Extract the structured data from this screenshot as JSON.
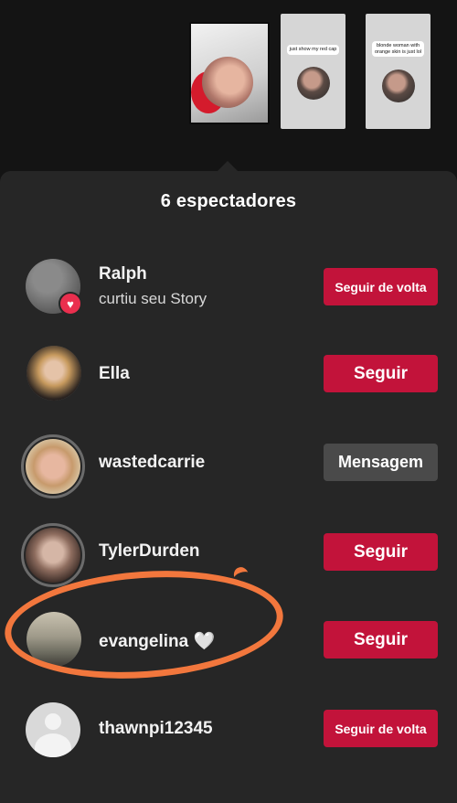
{
  "story_thumbnails": [
    {
      "caption": ""
    },
    {
      "caption": "just show my red cap"
    },
    {
      "caption": "blonde woman with orange skin is just lol"
    }
  ],
  "sheet": {
    "title": "6 espectadores"
  },
  "viewers": [
    {
      "name": "Ralph",
      "subtitle": "curtiu seu Story",
      "button": "Seguir de volta",
      "button_style": "red",
      "liked": true,
      "icon": "heart-icon"
    },
    {
      "name": "Ella",
      "subtitle": "",
      "button": "Seguir",
      "button_style": "red",
      "liked": false
    },
    {
      "name": "wastedcarrie",
      "subtitle": "",
      "button": "Mensagem",
      "button_style": "gray",
      "liked": false
    },
    {
      "name": "TylerDurden",
      "subtitle": "",
      "button": "Seguir",
      "button_style": "red",
      "liked": false
    },
    {
      "name": "evangelina 🤍",
      "subtitle": "",
      "button": "Seguir",
      "button_style": "red",
      "liked": false
    },
    {
      "name": "thawnpi12345",
      "subtitle": "",
      "button": "Seguir de volta",
      "button_style": "red",
      "liked": false
    }
  ],
  "colors": {
    "background": "#141414",
    "sheet": "#262626",
    "follow_button": "#c2133a",
    "message_button": "#4a4a4a",
    "annotation_circle": "#f2773d",
    "like_badge": "#ea2f4e"
  }
}
